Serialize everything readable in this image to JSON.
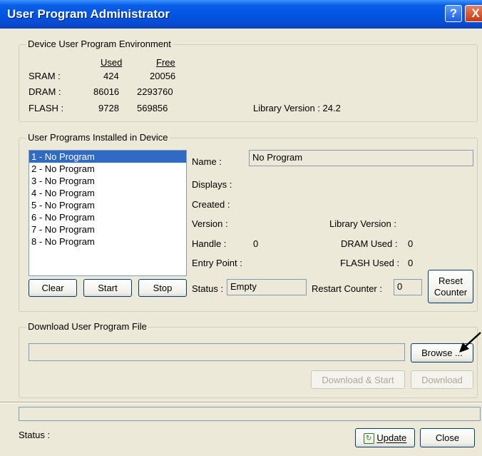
{
  "window": {
    "title": "User Program Administrator",
    "help_glyph": "?",
    "close_glyph": "X"
  },
  "environment": {
    "legend": "Device User Program Environment",
    "used_header": "Used",
    "free_header": "Free",
    "rows": [
      {
        "label": "SRAM :",
        "used": "424",
        "free": "20056"
      },
      {
        "label": "DRAM :",
        "used": "86016",
        "free": "2293760"
      },
      {
        "label": "FLASH :",
        "used": "9728",
        "free": "569856"
      }
    ],
    "library_version": "Library Version : 24.2"
  },
  "installed": {
    "legend": "User Programs Installed in Device",
    "programs": [
      "1 - No Program",
      "2 - No Program",
      "3 - No Program",
      "4 - No Program",
      "5 - No Program",
      "6 - No Program",
      "7 - No Program",
      "8 - No Program"
    ],
    "selected_index": 0,
    "name_label": "Name :",
    "name_value": "No Program",
    "displays_label": "Displays :",
    "created_label": "Created :",
    "version_label": "Version :",
    "library_version_label": "Library Version :",
    "handle_label": "Handle :",
    "handle_value": "0",
    "dram_used_label": "DRAM Used :",
    "dram_used_value": "0",
    "entry_point_label": "Entry Point :",
    "flash_used_label": "FLASH Used :",
    "flash_used_value": "0",
    "status_label": "Status :",
    "status_value": "Empty",
    "restart_counter_label": "Restart Counter :",
    "restart_counter_value": "0",
    "clear_label": "Clear",
    "start_label": "Start",
    "stop_label": "Stop",
    "reset_line1": "Reset",
    "reset_line2": "Counter"
  },
  "download": {
    "legend": "Download User Program File",
    "file_path": "",
    "browse_label": "Browse ...",
    "download_start_label": "Download & Start",
    "download_label": "Download"
  },
  "footer": {
    "status_label": "Status :",
    "update_label": "Update",
    "close_label": "Close"
  }
}
